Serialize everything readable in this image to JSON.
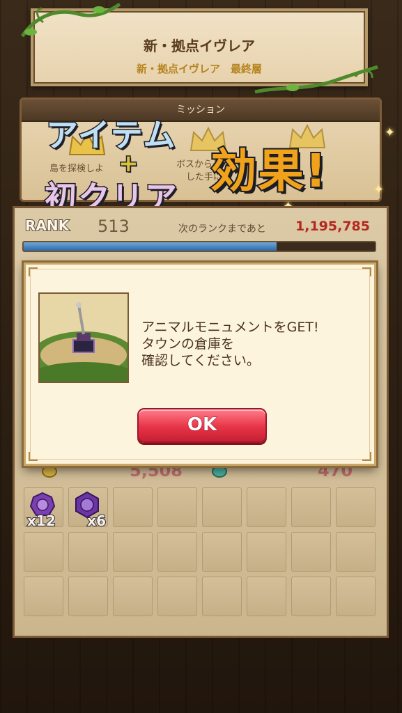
{
  "header": {
    "title": "新・拠点イヴレア",
    "subtitle": "新・拠点イヴレア　最終層"
  },
  "mission": {
    "heading": "ミッション",
    "text_left": "島を探検しよ",
    "text_right": "ボスからモ",
    "text_right2": "した手に"
  },
  "caption": {
    "line1": "アイテム",
    "plus": "+",
    "line2": "初クリア",
    "effect": "効果!"
  },
  "rank": {
    "label": "RANK",
    "value": "513",
    "next_label": "次のランクまであと",
    "next_value": "1,195,785",
    "progress": 0.72
  },
  "stats": {
    "left_value": "5,508",
    "right_value": "470"
  },
  "inventory": {
    "items": [
      {
        "icon": "purple-round-gem-icon",
        "count": "x12"
      },
      {
        "icon": "purple-hex-gem-icon",
        "count": "x6"
      }
    ],
    "total_slots": 24
  },
  "modal": {
    "message": "アニマルモニュメントをGET!\nタウンの倉庫を\n確認してください。",
    "image_icon": "animal-monument-icon",
    "ok_label": "OK"
  },
  "colors": {
    "ok_button": "#e73447",
    "next_value": "#b4291f",
    "xp_fill": "#2f6aa8"
  }
}
